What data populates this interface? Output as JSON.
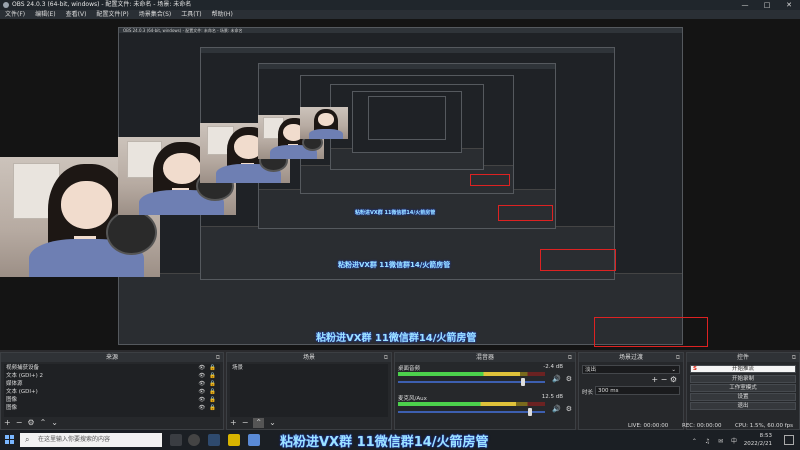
{
  "window": {
    "title": "OBS 24.0.3 (64-bit, windows) - 配置文件: 未命名 - 场景: 未命名",
    "controls": [
      "—",
      "□",
      "✕"
    ]
  },
  "menu": [
    "文件(F)",
    "编辑(E)",
    "查看(V)",
    "配置文件(P)",
    "场景集合(S)",
    "工具(T)",
    "帮助(H)"
  ],
  "nested": {
    "title": "OBS 24.0.3 (64-bit, windows) - 配置文件: 未命名 - 场景: 未命名"
  },
  "overlay": {
    "text": "粘粉进VX群 11微信群14/火箭房管"
  },
  "docks": {
    "sources": {
      "title": "来源",
      "items": [
        {
          "name": "视频捕获设备",
          "icons": "👁 🔒"
        },
        {
          "name": "文本 (GDI+) 2",
          "icons": "👁 🔒"
        },
        {
          "name": "媒体源",
          "icons": "👁 🔒"
        },
        {
          "name": "文本 (GDI+)",
          "icons": "👁 🔒"
        },
        {
          "name": "图像",
          "icons": "👁 🔒"
        },
        {
          "name": "图像",
          "icons": "👁 🔒"
        }
      ],
      "footer": [
        "+",
        "−",
        "⚙",
        "⌃",
        "⌄"
      ]
    },
    "scenes": {
      "title": "场景",
      "items": [
        "场景"
      ],
      "footer": [
        "+",
        "−",
        "⌃",
        "⌄"
      ]
    },
    "mixer": {
      "title": "混音器",
      "channels": [
        {
          "name": "桌面音频",
          "db": "-2.4 dB",
          "level": 0.83,
          "volume": 0.85
        },
        {
          "name": "麦克风/Aux",
          "db": "12.5 dB",
          "level": 0.8,
          "volume": 0.9
        }
      ]
    },
    "transitions": {
      "title": "场景过渡",
      "type": "淡出",
      "duration_label": "时长",
      "duration": "300 ms",
      "footer": [
        "+",
        "−",
        "⚙"
      ]
    },
    "controls": {
      "title": "控件",
      "buttons": [
        "开始推流",
        "开始录制",
        "工作室模式",
        "设置",
        "退出"
      ]
    }
  },
  "status": {
    "live": "LIVE: 00:00:00",
    "rec": "REC: 00:00:00",
    "cpu": "CPU: 1.5%, 60.00 fps"
  },
  "taskbar": {
    "search_placeholder": "在这里输入你要搜索的内容",
    "time": "8:53",
    "date": "2022/2/21",
    "tray_icons": "⌃ ♫ ✉ 中"
  },
  "colors": {
    "accent": "#3d5fb0",
    "meter_green": "#4cd14c",
    "meter_yellow": "#e0c23a",
    "highlight_red": "#dd2222",
    "overlay_text": "#9de3ff"
  }
}
